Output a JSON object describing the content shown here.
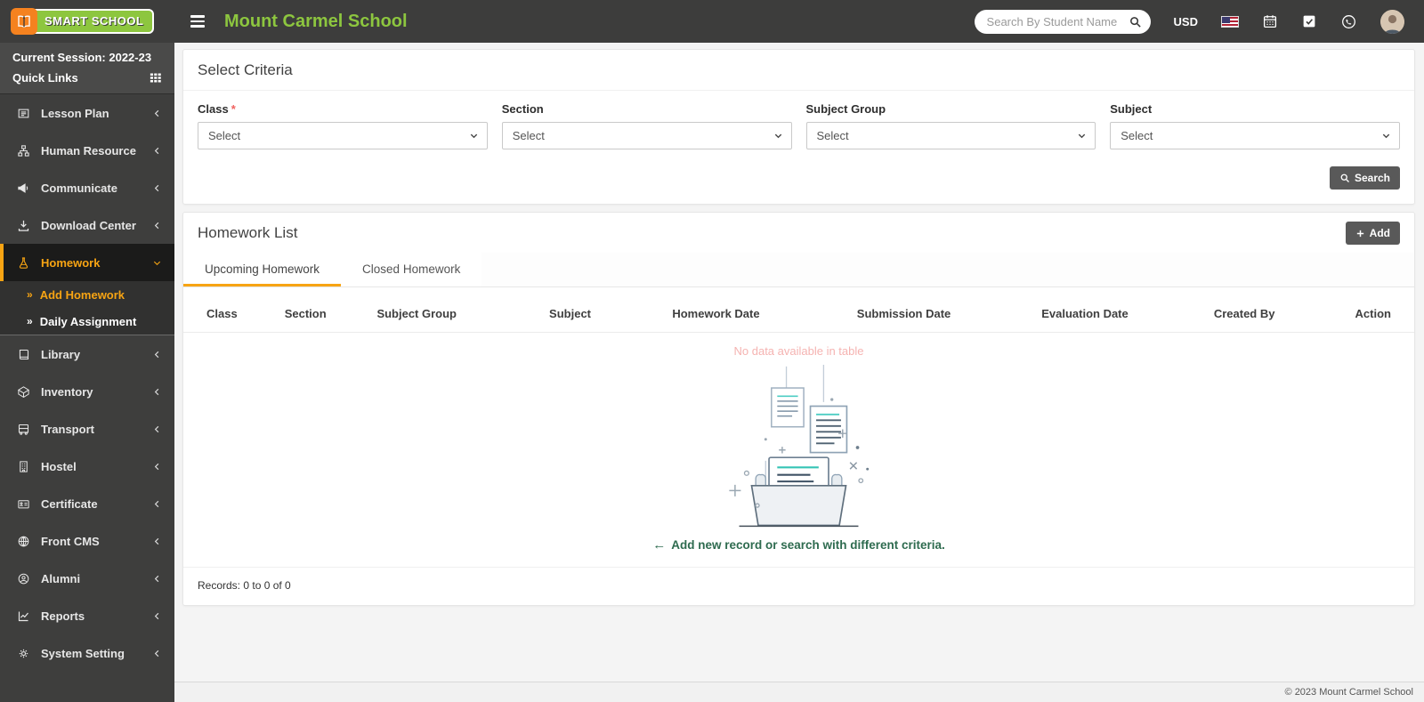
{
  "header": {
    "logo_text": "SMART SCHOOL",
    "school_name": "Mount Carmel School",
    "search_placeholder": "Search By Student Name",
    "currency": "USD"
  },
  "sidebar": {
    "session_label": "Current Session: 2022-23",
    "quick_links_label": "Quick Links",
    "items": [
      {
        "label": "Lesson Plan",
        "icon": "newspaper-icon"
      },
      {
        "label": "Human Resource",
        "icon": "sitemap-icon"
      },
      {
        "label": "Communicate",
        "icon": "bullhorn-icon"
      },
      {
        "label": "Download Center",
        "icon": "download-icon"
      },
      {
        "label": "Homework",
        "icon": "flask-icon",
        "active": true
      },
      {
        "label": "Library",
        "icon": "book-icon"
      },
      {
        "label": "Inventory",
        "icon": "box-icon"
      },
      {
        "label": "Transport",
        "icon": "bus-icon"
      },
      {
        "label": "Hostel",
        "icon": "building-icon"
      },
      {
        "label": "Certificate",
        "icon": "id-card-icon"
      },
      {
        "label": "Front CMS",
        "icon": "globe-icon"
      },
      {
        "label": "Alumni",
        "icon": "graduate-icon"
      },
      {
        "label": "Reports",
        "icon": "chart-line-icon"
      },
      {
        "label": "System Setting",
        "icon": "gears-icon"
      }
    ],
    "submenu": [
      {
        "label": "Add Homework",
        "active": true
      },
      {
        "label": "Daily Assignment",
        "active": false
      }
    ]
  },
  "icons": {
    "submenu_arrow": "»",
    "back_arrow": "←"
  },
  "criteria": {
    "title": "Select Criteria",
    "required_mark": "*",
    "fields": [
      {
        "label": "Class",
        "required": true,
        "value": "Select"
      },
      {
        "label": "Section",
        "required": false,
        "value": "Select"
      },
      {
        "label": "Subject Group",
        "required": false,
        "value": "Select"
      },
      {
        "label": "Subject",
        "required": false,
        "value": "Select"
      }
    ],
    "search_button": "Search"
  },
  "homework": {
    "title": "Homework List",
    "add_button": "Add",
    "tabs": [
      {
        "label": "Upcoming Homework",
        "active": true
      },
      {
        "label": "Closed Homework",
        "active": false
      }
    ],
    "columns": [
      "Class",
      "Section",
      "Subject Group",
      "Subject",
      "Homework Date",
      "Submission Date",
      "Evaluation Date",
      "Created By",
      "Action"
    ],
    "empty": {
      "no_data": "No data available in table",
      "hint": "Add new record or search with different criteria.",
      "records": "Records: 0 to 0 of 0"
    }
  },
  "footer": {
    "copyright": "© 2023 Mount Carmel School"
  },
  "colors": {
    "header_bg": "#3d3d3c",
    "brand_green": "#8dc63f",
    "logo_orange": "#f5821f",
    "accent_orange": "#f7a413",
    "button_gray": "#595959",
    "no_data_pink": "#f5b3b1",
    "hint_green": "#2e6b4f"
  }
}
